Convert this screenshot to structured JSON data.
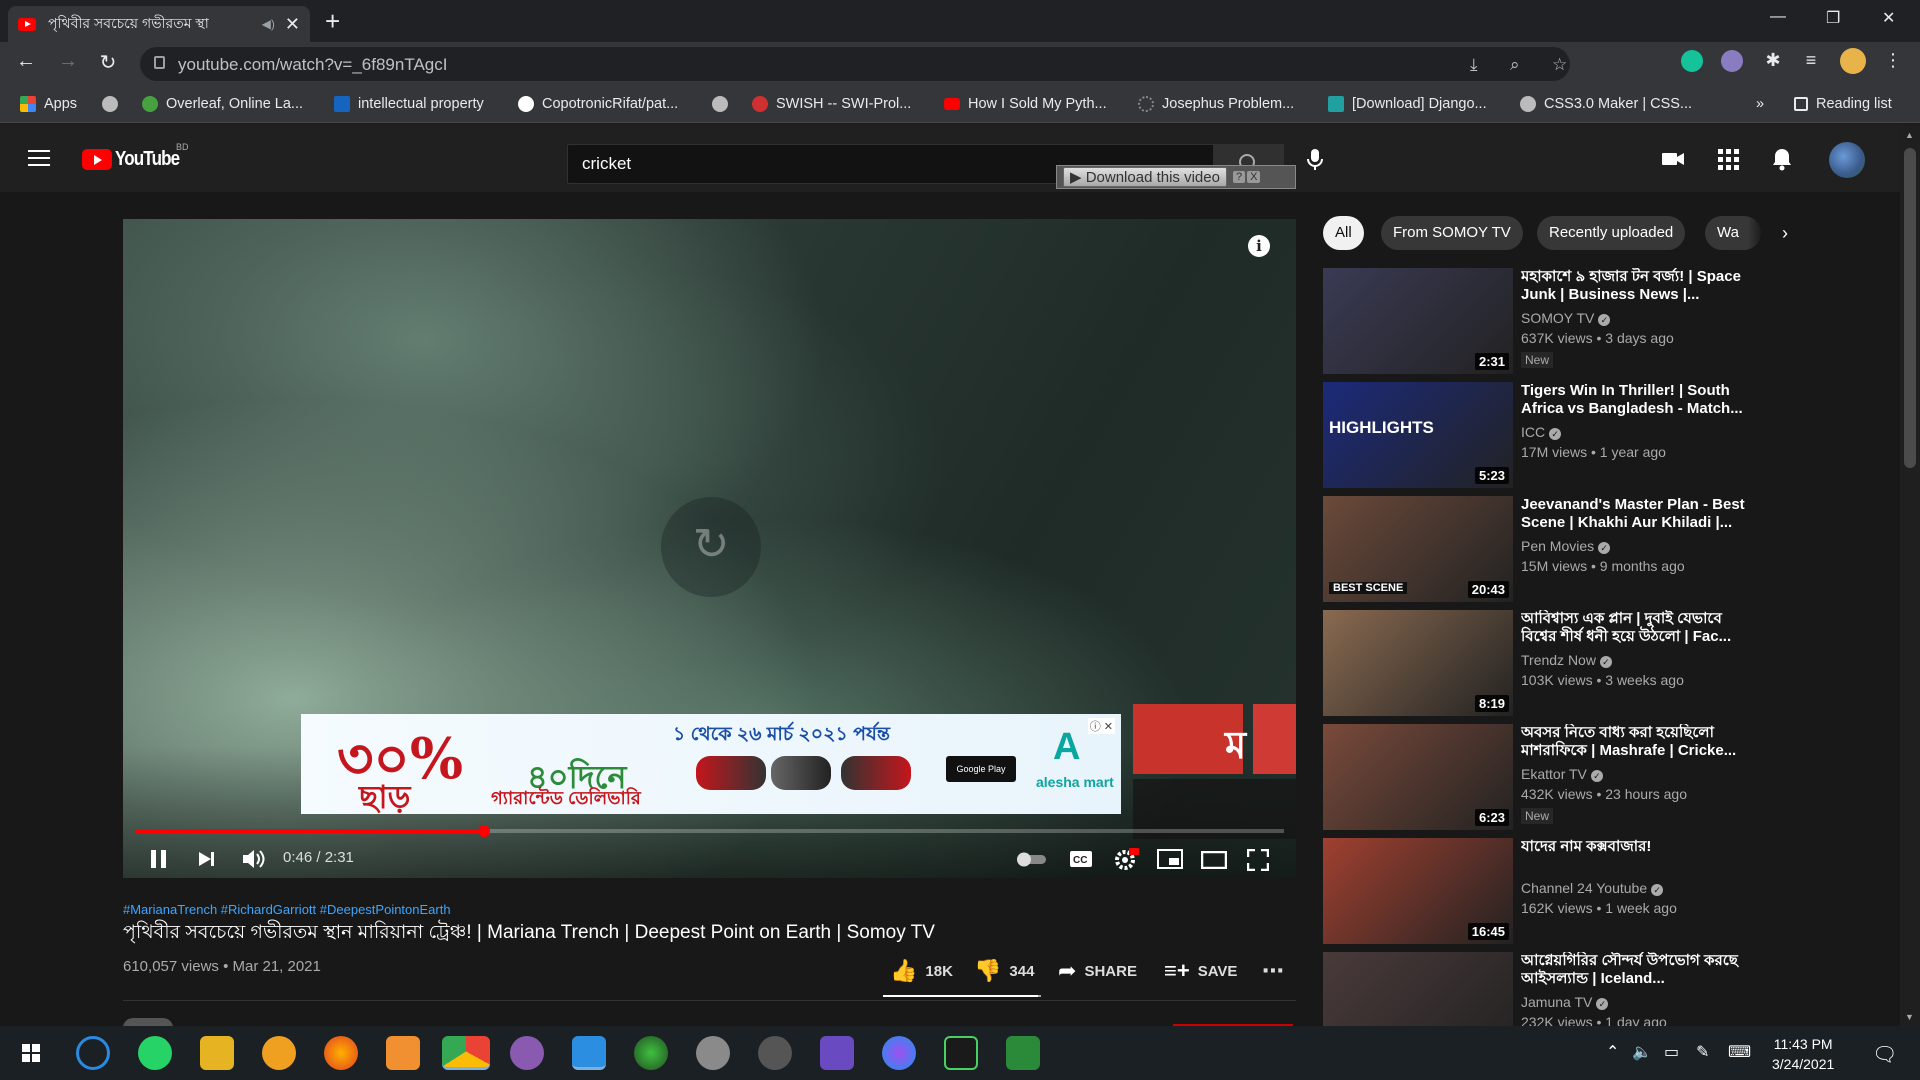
{
  "browser": {
    "tab_title": "পৃথিবীর সবচেয়ে গভীরতম স্থা",
    "url": "youtube.com/watch?v=_6f89nTAgcI",
    "bookmarks": [
      {
        "label": "Apps",
        "color": "#4285f4"
      },
      {
        "label": "",
        "color": "#bbbbbb"
      },
      {
        "label": "Overleaf, Online La...",
        "color": "#47a141"
      },
      {
        "label": "intellectual property",
        "color": "#1565c0"
      },
      {
        "label": "CopotronicRifat/pat...",
        "color": "#ffffff"
      },
      {
        "label": "",
        "color": "#bbbbbb"
      },
      {
        "label": "SWISH -- SWI-Prol...",
        "color": "#d03030"
      },
      {
        "label": "How I Sold My Pyth...",
        "color": "#ff0000"
      },
      {
        "label": "Josephus Problem...",
        "color": "#888888"
      },
      {
        "label": "[Download] Django...",
        "color": "#20a0a0"
      },
      {
        "label": "CSS3.0 Maker | CSS...",
        "color": "#bbbbbb"
      }
    ],
    "more": "»",
    "reading_list": "Reading list"
  },
  "youtube": {
    "logo_text": "YouTube",
    "country": "BD",
    "search_query": "cricket",
    "download_banner": "Download this video",
    "download_help": "?",
    "download_close": "X"
  },
  "player": {
    "time": "0:46 / 2:31",
    "progress": 0.304,
    "ad": {
      "percent": "৩০%",
      "off": "ছাড়",
      "date": "১ থেকে ২৬ মার্চ ২০২১ পর্যন্ত",
      "days": "৪০দিনে",
      "guarantee": "গ্যারান্টেড ডেলিভারি",
      "store": "Google Play",
      "brand": "alesha mart",
      "close": "ⓘ ✕"
    },
    "overlay_letter": "ম"
  },
  "video": {
    "hashtags": "#MarianaTrench #RichardGarriott #DeepestPointonEarth",
    "title": "পৃথিবীর সবচেয়ে গভীরতম স্থান মারিয়ানা ট্রেঞ্চ! | Mariana Trench | Deepest Point on Earth | Somoy TV",
    "meta": "610,057 views • Mar 21, 2021",
    "likes": "18K",
    "dislikes": "344",
    "share": "SHARE",
    "save": "SAVE",
    "like_ratio": 0.98
  },
  "chips": [
    "All",
    "From SOMOY TV",
    "Recently uploaded",
    "Wa"
  ],
  "related": [
    {
      "title": "মহাকাশে ৯ হাজার টন বর্জ্য! | Space Junk | Business News |...",
      "channel": "SOMOY TV",
      "views": "637K views • 3 days ago",
      "duration": "2:31",
      "badge": "New",
      "thumb": "#3a3a55"
    },
    {
      "title": "Tigers Win In Thriller! | South Africa vs Bangladesh - Match...",
      "channel": "ICC",
      "views": "17M views • 1 year ago",
      "duration": "5:23",
      "badge": "",
      "thumb": "#1c2a7a",
      "label": "HIGHLIGHTS"
    },
    {
      "title": "Jeevanand's Master Plan - Best Scene | Khakhi Aur Khiladi |...",
      "channel": "Pen Movies",
      "views": "15M views • 9 months ago",
      "duration": "20:43",
      "badge": "",
      "thumb": "#6b4a3a",
      "label": "BEST SCENE"
    },
    {
      "title": "আবিশ্বাস্য এক প্লান | দুবাই যেভাবে বিশ্বের শীর্ষ ধনী হয়ে উঠলো | Fac...",
      "channel": "Trendz Now",
      "views": "103K views • 3 weeks ago",
      "duration": "8:19",
      "badge": "",
      "thumb": "#8a6a50"
    },
    {
      "title": "অবসর নিতে বাধ্য করা হয়েছিলো মাশরাফিকে | Mashrafe | Cricke...",
      "channel": "Ekattor TV",
      "views": "432K views • 23 hours ago",
      "duration": "6:23",
      "badge": "New",
      "thumb": "#7a4a3a"
    },
    {
      "title": "যাদের নাম কক্সবাজার!",
      "channel": "Channel 24 Youtube",
      "views": "162K views • 1 week ago",
      "duration": "16:45",
      "badge": "",
      "thumb": "#a04030"
    },
    {
      "title": "আগ্নেয়গিরির সৌন্দর্য উপভোগ করছে আইসল্যান্ড | Iceland...",
      "channel": "Jamuna TV",
      "views": "232K views • 1 day ago",
      "duration": "",
      "badge": "",
      "thumb": "#4a3a3a"
    }
  ],
  "taskbar": {
    "time": "11:43 PM",
    "date": "3/24/2021"
  }
}
